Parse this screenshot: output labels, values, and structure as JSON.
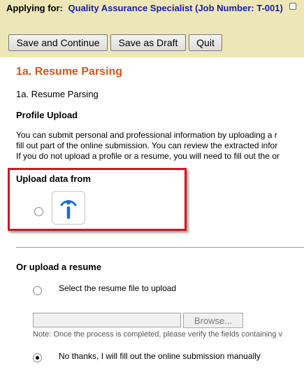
{
  "header": {
    "applying_label": "Applying for:",
    "job_title": "Quality Assurance Specialist (Job Number: T-001)"
  },
  "toolbar": {
    "save_continue": "Save and Continue",
    "save_draft": "Save as Draft",
    "quit": "Quit"
  },
  "main": {
    "section_title": "1a. Resume Parsing",
    "section_subtitle": "1a. Resume Parsing",
    "profile_heading": "Profile Upload",
    "paragraph_line1": "You can submit personal and professional information by uploading a r",
    "paragraph_line2": "fill out part of the online submission. You can review the extracted infor",
    "paragraph_line3": "If you do not upload a profile or a resume, you will need to fill out the or",
    "upload_heading": "Upload data from",
    "resume_heading": "Or upload a resume",
    "option_select_file": "Select the resume file to upload",
    "browse_label": "Browse...",
    "note": "Note: Once the process is completed, please verify the fields containing v",
    "option_manual": "No thanks, I will fill out the online submission manually"
  },
  "icons": {
    "upload_provider": "info-i-icon"
  },
  "colors": {
    "header_bg": "#ede7b7",
    "job_title": "#1a1ab4",
    "section_title": "#d2591a",
    "highlight_box": "#d9141c"
  },
  "state": {
    "selected_option": "manual"
  }
}
